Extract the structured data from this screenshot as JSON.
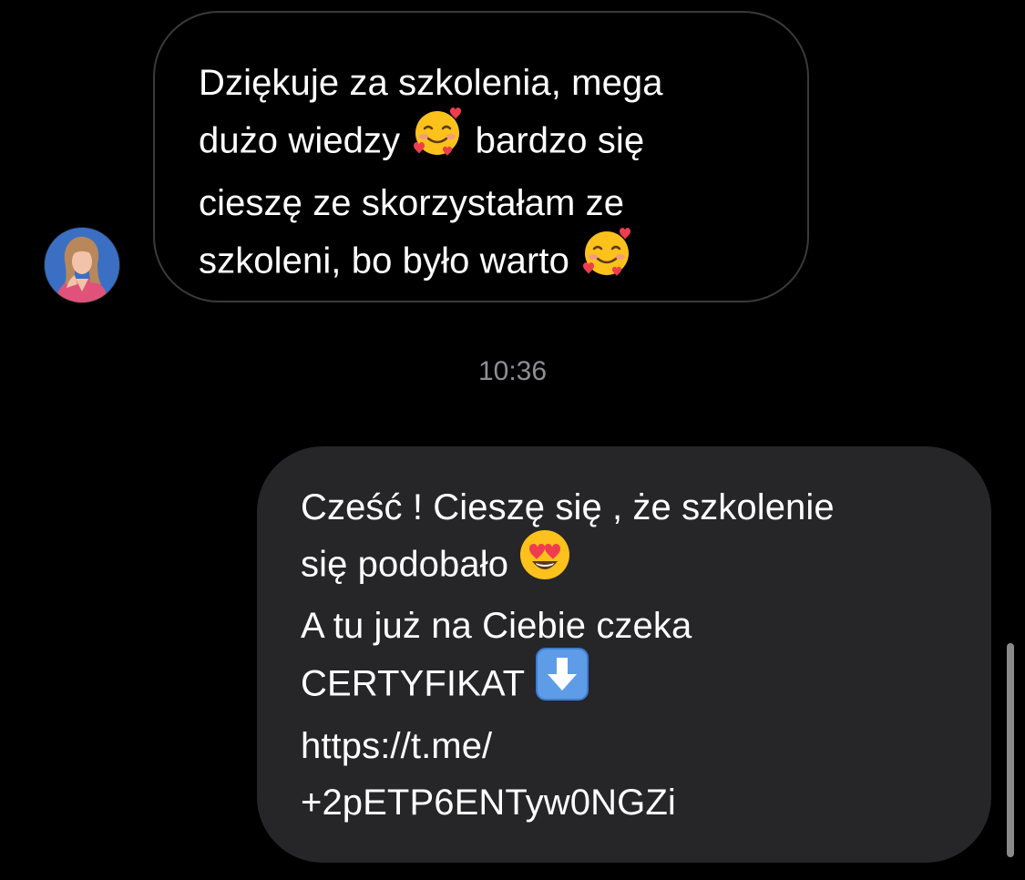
{
  "conversation": {
    "incoming": {
      "avatar_icon": "profile-photo-woman-pink-blazer",
      "lines": [
        [
          "Dziękuje za szkolenia, mega"
        ],
        [
          "dużo wiedzy ",
          "smiling-face-with-hearts-emoji",
          " bardzo się"
        ],
        [
          "cieszę ze skorzystałam ze"
        ],
        [
          "szkoleni, bo było warto ",
          "smiling-face-with-hearts-emoji"
        ]
      ]
    },
    "timestamp": "10:36",
    "outgoing": {
      "lines": [
        [
          "Cześć ! Cieszę się , że szkolenie"
        ],
        [
          "się podobało ",
          "heart-eyes-emoji"
        ],
        [
          "A tu już na Ciebie czeka"
        ],
        [
          "CERTYFIKAT ",
          "down-arrow-emoji"
        ]
      ],
      "link_lines": [
        "https://t.me/",
        "+2pETP6ENTyw0NGZi"
      ]
    }
  },
  "colors": {
    "background": "#000000",
    "incoming_border": "#3a3a3c",
    "outgoing_bubble": "#262628",
    "timestamp": "#8e8e93",
    "text": "#ffffff"
  }
}
